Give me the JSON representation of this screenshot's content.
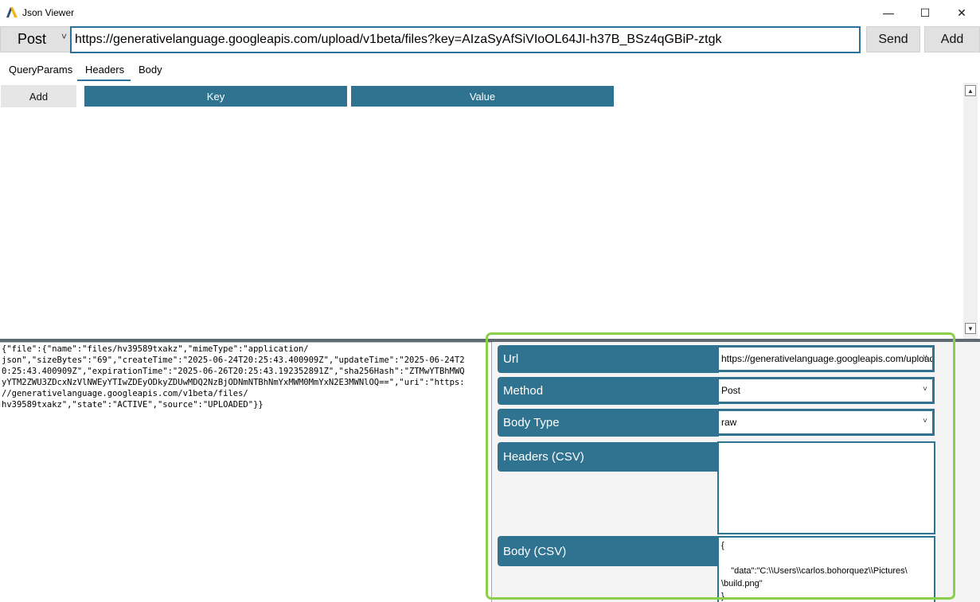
{
  "window": {
    "title": "Json Viewer",
    "minimize": "—",
    "maximize": "☐",
    "close": "✕"
  },
  "request": {
    "method": "Post",
    "url": "https://generativelanguage.googleapis.com/upload/v1beta/files?key=AIzaSyAfSiVIoOL64JI-h37B_BSz4qGBiP-ztgk",
    "send_label": "Send",
    "add_label": "Add"
  },
  "tabs": [
    "QueryParams",
    "Headers",
    "Body"
  ],
  "headers_grid": {
    "add_label": "Add",
    "key_header": "Key",
    "value_header": "Value"
  },
  "response": {
    "text": "{\"file\":{\"name\":\"files/hv39589txakz\",\"mimeType\":\"application/\njson\",\"sizeBytes\":\"69\",\"createTime\":\"2025-06-24T20:25:43.400909Z\",\"updateTime\":\"2025-06-24T2\n0:25:43.400909Z\",\"expirationTime\":\"2025-06-26T20:25:43.192352891Z\",\"sha256Hash\":\"ZTMwYTBhMWQ\nyYTM2ZWU3ZDcxNzVlNWEyYTIwZDEyODkyZDUwMDQ2NzBjODNmNTBhNmYxMWM0MmYxN2E3MWNlOQ==\",\"uri\":\"https:\n//generativelanguage.googleapis.com/v1beta/files/\nhv39589txakz\",\"state\":\"ACTIVE\",\"source\":\"UPLOADED\"}}"
  },
  "properties": {
    "url_label": "Url",
    "url_value": "https://generativelanguage.googleapis.com/upload/v1beta/files?key=AIzaSyAfSiVIoOL64JI-h37B_BSz4qGBiP-ztgk",
    "method_label": "Method",
    "method_value": "Post",
    "body_type_label": "Body Type",
    "body_type_value": "raw",
    "headers_label": "Headers (CSV)",
    "headers_value": "",
    "body_label": "Body (CSV)",
    "body_value": "{\n\n    \"data\":\"C:\\\\Users\\\\carlos.bohorquez\\\\Pictures\\\n\\build.png\"\n}"
  },
  "colors": {
    "accent": "#2f7391",
    "highlight": "#8bd04a",
    "url_border": "#2f6f9b"
  },
  "icons": {
    "app": "app-logo-icon",
    "dropdown": "chevron-down-icon"
  }
}
